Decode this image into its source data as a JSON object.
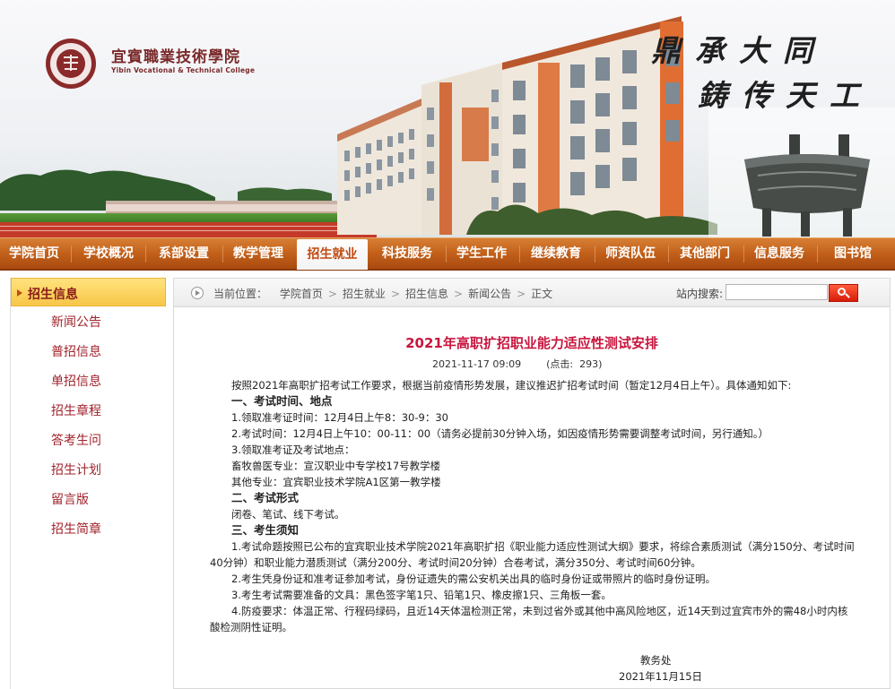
{
  "header": {
    "logo_cn": "宜賓職業技術學院",
    "logo_en": "Yibin Vocational & Technical College",
    "slogan_line1": "鼎承大同",
    "slogan_line2": "鋳传天工"
  },
  "nav": {
    "items": [
      "学院首页",
      "学校概况",
      "系部设置",
      "教学管理",
      "招生就业",
      "科技服务",
      "学生工作",
      "继续教育",
      "师资队伍",
      "其他部门",
      "信息服务",
      "图书馆"
    ],
    "active": "招生就业"
  },
  "sidebar": {
    "title": "招生信息",
    "items": [
      "新闻公告",
      "普招信息",
      "单招信息",
      "招生章程",
      "答考生问",
      "招生计划",
      "留言版",
      "招生简章"
    ]
  },
  "breadcrumb": {
    "label": "当前位置：",
    "items": [
      "学院首页",
      "招生就业",
      "招生信息",
      "新闻公告",
      "正文"
    ]
  },
  "search": {
    "label": "站内搜索:",
    "value": ""
  },
  "article": {
    "title": "2021年高职扩招职业能力适应性测试安排",
    "meta": "2021-11-17 09:09        (点击:  293)",
    "intro": "按照2021年高职扩招考试工作要求，根据当前疫情形势发展，建议推迟扩招考试时间（暂定12月4日上午）。具体通知如下:",
    "section1_title": "一、考试时间、地点",
    "s1_item1": "1.领取准考证时间：12月4日上午8：30-9：30",
    "s1_item2": "2.考试时间：12月4日上午10：00-11：00（请务必提前30分钟入场，如因疫情形势需要调整考试时间，另行通知。）",
    "s1_item3": "3.领取准考证及考试地点：",
    "s1_item3a": "畜牧兽医专业：宣汉职业中专学校17号教学楼",
    "s1_item3b": "其他专业：宜宾职业技术学院A1区第一教学楼",
    "section2_title": "二、考试形式",
    "s2_text": "闭卷、笔试、线下考试。",
    "section3_title": "三、考生须知",
    "s3_item1": "1.考试命题按照已公布的宜宾职业技术学院2021年高职扩招《职业能力适应性测试大纲》要求，将综合素质测试（满分150分、考试时间40分钟）和职业能力潜质测试（满分200分、考试时间20分钟）合卷考试，满分350分、考试时间60分钟。",
    "s3_item2": "2.考生凭身份证和准考证参加考试，身份证遗失的需公安机关出具的临时身份证或带照片的临时身份证明。",
    "s3_item3": "3.考生考试需要准备的文具：黑色签字笔1只、铅笔1只、橡皮擦1只、三角板一套。",
    "s3_item4": "4.防疫要求：体温正常、行程码绿码，且近14天体温检测正常，未到过省外或其他中高风险地区，近14天到过宜宾市外的需48小时内核酸检测阴性证明。",
    "signature": "教务处",
    "date": "2021年11月15日"
  }
}
